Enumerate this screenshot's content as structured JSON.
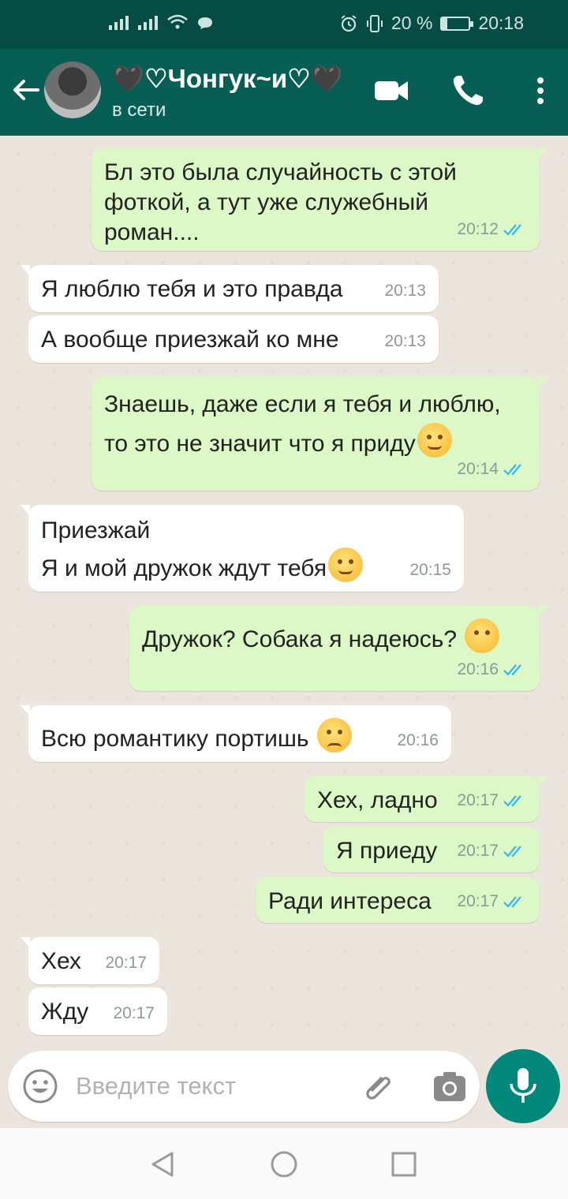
{
  "status_bar": {
    "battery_text": "20 %",
    "battery_level": 0.2,
    "time": "20:18"
  },
  "header": {
    "contact_name": "🖤♡Чонгук~и♡🖤",
    "status": "в сети",
    "icons": [
      "back-arrow-icon",
      "video-call-icon",
      "phone-icon",
      "more-vertical-icon"
    ]
  },
  "messages": [
    {
      "dir": "out",
      "text": "Бл это была случайность с этой\nфоткой, а тут уже служебный\nроман....",
      "time": "20:12",
      "status": "read"
    },
    {
      "dir": "in",
      "text": "Я люблю тебя и это правда",
      "time": "20:13"
    },
    {
      "dir": "in",
      "text": "А вообще приезжай ко мне",
      "time": "20:13"
    },
    {
      "dir": "out",
      "text": "Знаешь, даже если я тебя и люблю,\nто это не значит что я приду",
      "emoji": "smirking-face",
      "time": "20:14",
      "status": "read"
    },
    {
      "dir": "in",
      "text": "Приезжай\nЯ и мой дружок ждут тебя",
      "emoji": "smirking-face",
      "time": "20:15"
    },
    {
      "dir": "out",
      "text": "Дружок? Собака я надеюсь?",
      "emoji": "face-without-mouth",
      "time": "20:16",
      "status": "read"
    },
    {
      "dir": "in",
      "text": "Всю романтику портишь",
      "emoji": "unamused-face",
      "time": "20:16"
    },
    {
      "dir": "out",
      "text": "Хех, ладно",
      "time": "20:17",
      "status": "read"
    },
    {
      "dir": "out",
      "text": "Я приеду",
      "time": "20:17",
      "status": "read"
    },
    {
      "dir": "out",
      "text": "Ради интереса",
      "time": "20:17",
      "status": "read"
    },
    {
      "dir": "in",
      "text": "Хех",
      "time": "20:17"
    },
    {
      "dir": "in",
      "text": "Жду",
      "time": "20:17"
    }
  ],
  "input": {
    "placeholder": "Введите текст",
    "value": ""
  },
  "colors": {
    "header": "#075E54",
    "status_bar": "#054D44",
    "outgoing_bubble": "#DCF8C6",
    "incoming_bubble": "#FFFFFF",
    "read_ticks": "#34B7F1",
    "mic_button": "#00897B",
    "chat_background": "#ECE5DD"
  }
}
